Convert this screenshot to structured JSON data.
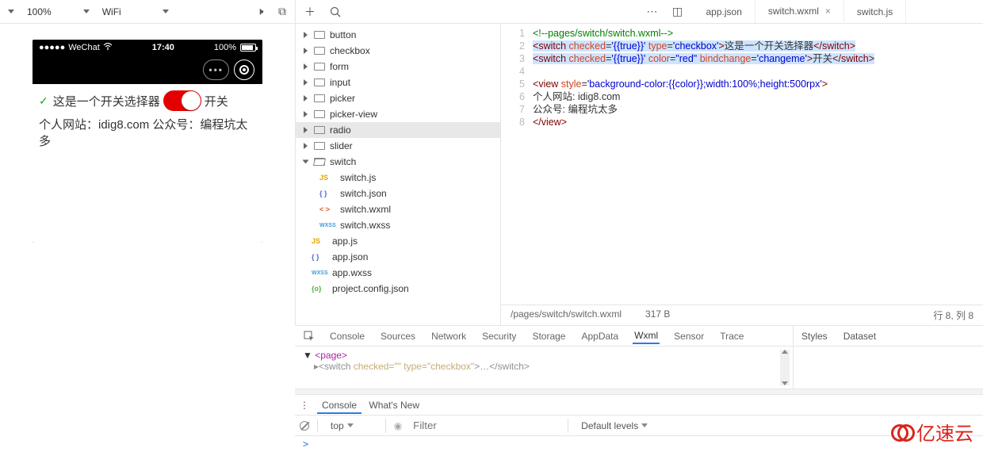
{
  "toolbar": {
    "zoom": "100%",
    "network": "WiFi"
  },
  "tabs": [
    {
      "label": "app.json",
      "active": false,
      "close": false
    },
    {
      "label": "switch.wxml",
      "active": true,
      "close": true
    },
    {
      "label": "switch.js",
      "active": false,
      "close": false
    }
  ],
  "simulator": {
    "carrier": "WeChat",
    "time": "17:40",
    "battery": "100%",
    "checkbox_label": "这是一个开关选择器",
    "switch_label": "开关",
    "line2": "个人网站：idig8.com 公众号：编程坑太多"
  },
  "tree": {
    "folders": [
      "button",
      "checkbox",
      "form",
      "input",
      "picker",
      "picker-view",
      "radio",
      "slider"
    ],
    "open_folder": "switch",
    "open_files": [
      {
        "name": "switch.js",
        "type": "js"
      },
      {
        "name": "switch.json",
        "type": "json"
      },
      {
        "name": "switch.wxml",
        "type": "wxml"
      },
      {
        "name": "switch.wxss",
        "type": "wxss"
      }
    ],
    "root_files": [
      {
        "name": "app.js",
        "type": "js"
      },
      {
        "name": "app.json",
        "type": "json"
      },
      {
        "name": "app.wxss",
        "type": "wxss"
      },
      {
        "name": "project.config.json",
        "type": "cfg"
      }
    ],
    "selected": "radio"
  },
  "editor": {
    "lines": [
      {
        "n": 1,
        "type": "comment",
        "raw": "<!--pages/switch/switch.wxml-->"
      },
      {
        "n": 2,
        "type": "hl",
        "parts": [
          "<",
          "switch",
          " checked",
          "=",
          "'{{true}}'",
          " type",
          "=",
          "'checkbox'",
          ">",
          "这是一个开关选择器",
          "</",
          "switch",
          ">"
        ]
      },
      {
        "n": 3,
        "type": "hl",
        "parts": [
          "<",
          "switch",
          " checked",
          "=",
          "'{{true}}'",
          " color",
          "=",
          "\"red\"",
          " bindchange",
          "=",
          "'changeme'",
          ">",
          "开关",
          "</",
          "switch",
          ">"
        ]
      },
      {
        "n": 4,
        "type": "blank"
      },
      {
        "n": 5,
        "type": "tag",
        "parts": [
          "<",
          "view",
          " style",
          "=",
          "'background-color:{{color}};width:100%;height:500rpx'",
          ">"
        ]
      },
      {
        "n": 6,
        "type": "text",
        "raw": "个人网站: idig8.com"
      },
      {
        "n": 7,
        "type": "text",
        "raw": "公众号: 编程坑太多"
      },
      {
        "n": 8,
        "type": "tag",
        "parts": [
          "</",
          "view",
          ">"
        ]
      }
    ],
    "status_path": "/pages/switch/switch.wxml",
    "status_size": "317 B",
    "status_pos": "行 8, 列 8"
  },
  "devtools": {
    "tabs": [
      "Console",
      "Sources",
      "Network",
      "Security",
      "Storage",
      "AppData",
      "Wxml",
      "Sensor",
      "Trace"
    ],
    "active": "Wxml",
    "dom_line1": "<page>",
    "dom_line2_pre": "▸<switch ",
    "dom_line2_attrs": "checked=\"\" type=\"checkbox\"",
    "dom_line2_post": ">…</switch>",
    "styles_tabs": [
      "Styles",
      "Dataset"
    ]
  },
  "console": {
    "tabs": [
      "Console",
      "What's New"
    ],
    "active": "Console",
    "context": "top",
    "filter_placeholder": "Filter",
    "levels": "Default levels",
    "prompt": ">"
  },
  "watermark": "亿速云"
}
